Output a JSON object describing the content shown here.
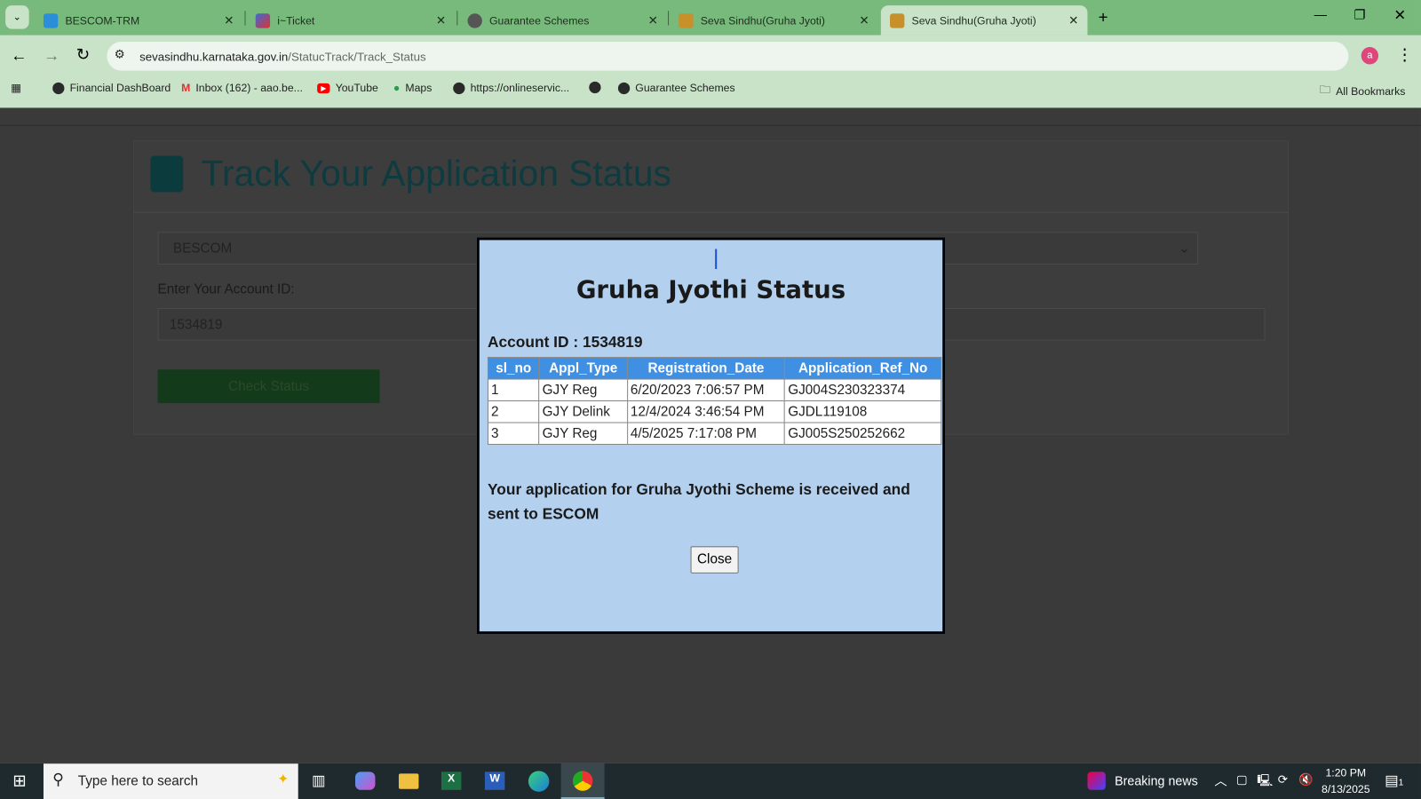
{
  "browser": {
    "tabs": [
      {
        "label": "BESCOM-TRM"
      },
      {
        "label": "i~Ticket"
      },
      {
        "label": "Guarantee Schemes"
      },
      {
        "label": "Seva Sindhu(Gruha Jyoti)"
      },
      {
        "label": "Seva Sindhu(Gruha Jyoti)",
        "active": true
      }
    ],
    "url_host": "sevasindhu.karnataka.gov.in",
    "url_path": "/StatucTrack/Track_Status",
    "profile_initial": "a",
    "bookmarks": [
      "Financial DashBoard",
      "Inbox (162) - aao.be...",
      "YouTube",
      "Maps",
      "https://onlineservic...",
      "",
      "Guarantee Schemes"
    ],
    "all_bookmarks": "All Bookmarks"
  },
  "page": {
    "title": "Track Your Application Status",
    "escom_select": "BESCOM",
    "account_label": "Enter Your Account ID:",
    "account_value": "1534819",
    "check_button": "Check Status"
  },
  "modal": {
    "cursor": "|",
    "title": "Gruha Jyothi Status",
    "account_line": "Account ID : 1534819",
    "columns": [
      "sl_no",
      "Appl_Type",
      "Registration_Date",
      "Application_Ref_No"
    ],
    "rows": [
      [
        "1",
        "GJY Reg",
        "6/20/2023 7:06:57 PM",
        "GJ004S230323374"
      ],
      [
        "2",
        "GJY Delink",
        "12/4/2024 3:46:54 PM",
        "GJDL119108"
      ],
      [
        "3",
        "GJY Reg",
        "4/5/2025 7:17:08 PM",
        "GJ005S250252662"
      ]
    ],
    "message": "Your application for Gruha Jyothi Scheme is received and sent to ESCOM",
    "close": "Close"
  },
  "taskbar": {
    "search_placeholder": "Type here to search",
    "news": "Breaking news",
    "time": "1:20 PM",
    "date": "8/13/2025",
    "notif_count": "1"
  },
  "colors": {
    "tabbar": "#78b97c",
    "header": "#3f8fe2",
    "modal": "#b3d0ee"
  }
}
